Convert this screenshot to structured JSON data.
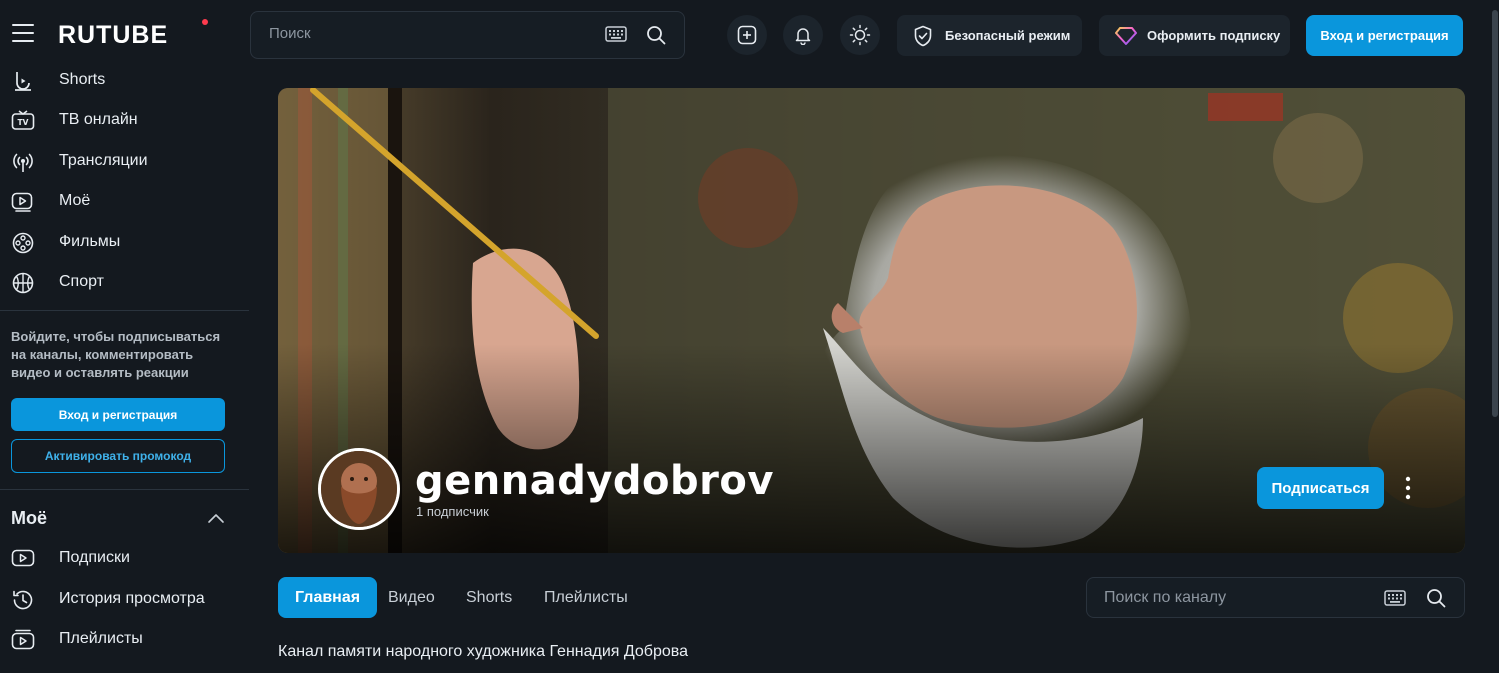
{
  "header": {
    "logo": "RUTUBE",
    "search_placeholder": "Поиск",
    "safe_mode_label": "Безопасный режим",
    "subscription_label": "Оформить подписку",
    "login_label": "Вход и регистрация"
  },
  "sidebar": {
    "items": [
      {
        "label": "Shorts",
        "icon": "shorts-icon"
      },
      {
        "label": "ТВ онлайн",
        "icon": "tv-icon"
      },
      {
        "label": "Трансляции",
        "icon": "broadcast-icon"
      },
      {
        "label": "Моё",
        "icon": "play-icon"
      },
      {
        "label": "Фильмы",
        "icon": "film-reel-icon"
      },
      {
        "label": "Спорт",
        "icon": "ball-icon"
      }
    ],
    "login_note": "Войдите, чтобы подписываться на каналы, комментировать видео и оставлять реакции",
    "login_button": "Вход и регистрация",
    "promo_button": "Активировать промокод",
    "moe_heading": "Моё",
    "moe_items": [
      {
        "label": "Подписки",
        "icon": "subscriptions-icon"
      },
      {
        "label": "История просмотра",
        "icon": "history-icon"
      },
      {
        "label": "Плейлисты",
        "icon": "playlist-icon"
      }
    ]
  },
  "channel": {
    "name": "gennadydobrov",
    "subscribers": "1 подписчик",
    "subscribe_button": "Подписаться",
    "description": "Канал памяти народного художника Геннадия Доброва"
  },
  "tabs": [
    {
      "label": "Главная",
      "active": true
    },
    {
      "label": "Видео",
      "active": false
    },
    {
      "label": "Shorts",
      "active": false
    },
    {
      "label": "Плейлисты",
      "active": false
    }
  ],
  "channel_search_placeholder": "Поиск по каналу",
  "colors": {
    "accent": "#0a96dc",
    "background": "#14191f",
    "logo_dot": "#ff3b4e"
  }
}
